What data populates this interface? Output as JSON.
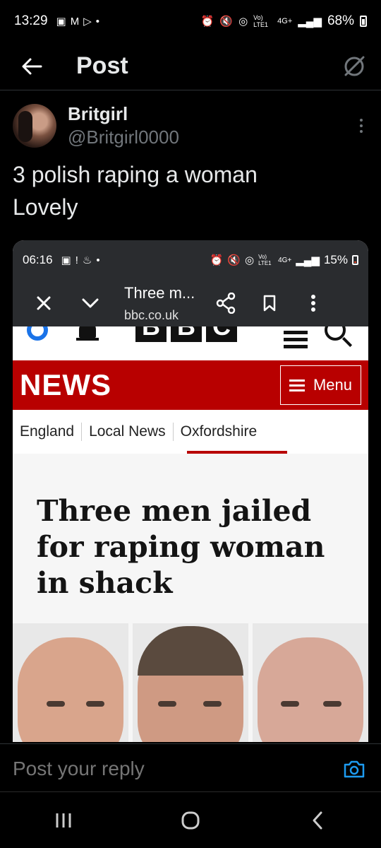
{
  "status_bar": {
    "time": "13:29",
    "battery": "68%",
    "network": "4G+",
    "volte": "Vo) LTE1"
  },
  "header": {
    "title": "Post"
  },
  "author": {
    "name": "Britgirl",
    "handle": "@Britgirl0000"
  },
  "post": {
    "lines": [
      "3 polish raping a woman",
      "Lovely"
    ]
  },
  "embed": {
    "status": {
      "time": "06:16",
      "battery": "15%",
      "network": "4G+",
      "volte": "Vo) LTE1"
    },
    "toolbar": {
      "page_title": "Three m...",
      "domain": "bbc.co.uk"
    },
    "site": {
      "logo_letters": [
        "B",
        "B",
        "C"
      ],
      "section": "NEWS",
      "menu_label": "Menu",
      "breadcrumbs": [
        "England",
        "Local News",
        "Oxfordshire"
      ],
      "headline_lines": [
        "Three men jailed",
        "for raping woman",
        "in shack"
      ]
    }
  },
  "reply": {
    "placeholder": "Post your reply"
  },
  "colors": {
    "background": "#000000",
    "bbc_red": "#b80000",
    "link_blue": "#1d9bf0"
  }
}
